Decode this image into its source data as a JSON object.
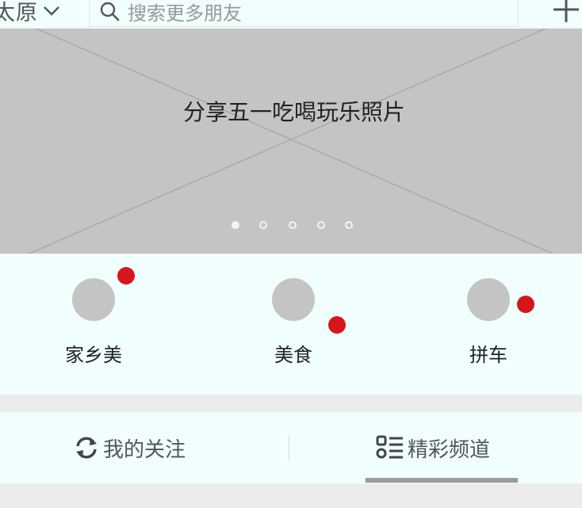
{
  "header": {
    "city": "太原",
    "search_placeholder": "搜索更多朋友",
    "icons": [
      "chevron-down-icon",
      "search-icon",
      "plus-icon"
    ]
  },
  "banner": {
    "title": "分享五一吃喝玩乐照片",
    "slide_count": 5,
    "active_slide": 1
  },
  "categories": [
    {
      "label": "家乡美",
      "has_badge": true
    },
    {
      "label": "美食",
      "has_badge": true
    },
    {
      "label": "拼车",
      "has_badge": true
    }
  ],
  "tabs": [
    {
      "label": "我的关注",
      "icon": "refresh-icon",
      "selected": false
    },
    {
      "label": "精彩频道",
      "icon": "list-icon",
      "selected": true
    }
  ],
  "colors": {
    "background": "#f0fefe",
    "placeholder": "#c4c4c2",
    "badge": "#d8141c",
    "underline": "#9b9b9b"
  }
}
